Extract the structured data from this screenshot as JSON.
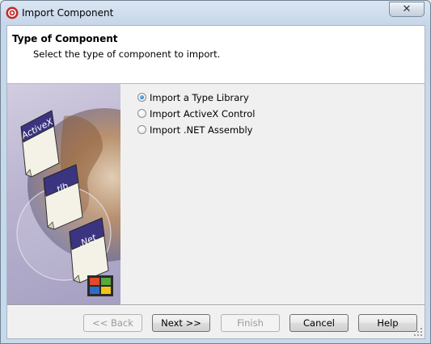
{
  "window": {
    "title": "Import Component",
    "close_glyph": "✕"
  },
  "header": {
    "title": "Type of Component",
    "subtitle": "Select the type of component to import."
  },
  "side_image": {
    "cards": [
      "ActiveX",
      ".tlb",
      ".Net"
    ]
  },
  "options": [
    {
      "label": "Import a Type Library",
      "checked": true
    },
    {
      "label": "Import ActiveX Control",
      "checked": false
    },
    {
      "label": "Import .NET Assembly",
      "checked": false
    }
  ],
  "buttons": {
    "back": "<< Back",
    "next": "Next >>",
    "finish": "Finish",
    "cancel": "Cancel",
    "help": "Help"
  },
  "colors": {
    "title_bar": "#c9d9ec",
    "radio_selected": "#1f63b5",
    "side_panel": "#b9b3d0"
  },
  "icons": [
    "app-icon",
    "close-icon",
    "windows-logo-icon",
    "resize-grip-icon"
  ]
}
